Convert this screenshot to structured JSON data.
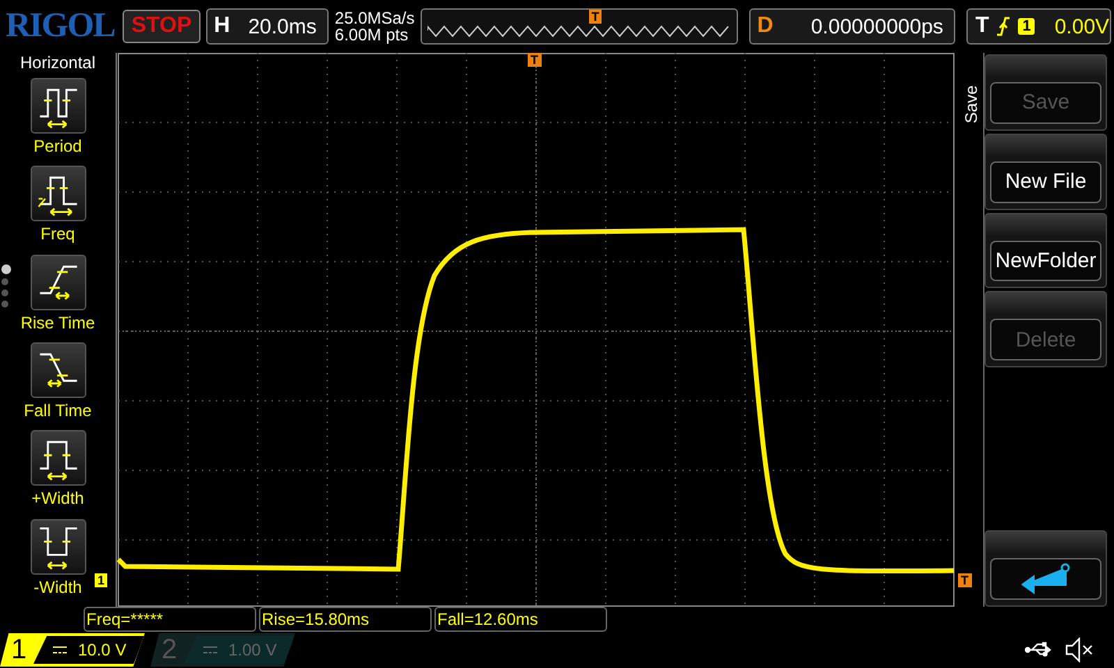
{
  "top_bar": {
    "logo": "RIGOL",
    "run_state": "STOP",
    "timebase": {
      "label": "H",
      "value": "20.0ms"
    },
    "sample_rate": "25.0MSa/s",
    "memory_depth": "6.00M pts",
    "trigger_position_marker": "T",
    "delay": {
      "label": "D",
      "value": "0.00000000ps"
    },
    "trigger": {
      "label": "T",
      "source": "1",
      "level": "0.00V"
    }
  },
  "measure_menu": {
    "title": "Horizontal",
    "pages": [
      {
        "selected": true
      },
      {
        "selected": false
      },
      {
        "selected": false
      },
      {
        "selected": false
      }
    ],
    "items": [
      {
        "kind": "period",
        "label": "Period"
      },
      {
        "kind": "freq",
        "label": "Freq"
      },
      {
        "kind": "rise",
        "label": "Rise Time"
      },
      {
        "kind": "fall",
        "label": "Fall Time"
      },
      {
        "kind": "pwidth",
        "label": "+Width"
      },
      {
        "kind": "nwidth",
        "label": "-Width"
      }
    ]
  },
  "screen": {
    "channel_marker": "1",
    "trigger_marker": "T",
    "trigger_level_marker": "T"
  },
  "soft_menu": {
    "title": "Save",
    "buttons": [
      {
        "kind": "text",
        "label": "Save",
        "disabled": true
      },
      {
        "kind": "text",
        "label": "New File",
        "disabled": false
      },
      {
        "kind": "text",
        "label": "NewFolder",
        "disabled": false
      },
      {
        "kind": "text",
        "label": "Delete",
        "disabled": true
      },
      {
        "kind": "spacer"
      },
      {
        "kind": "return",
        "disabled": false
      }
    ]
  },
  "measurements": [
    "Freq=*****",
    "Rise=15.80ms",
    "Fall=12.60ms"
  ],
  "channels": [
    {
      "number": "1",
      "scale": "10.0 V",
      "on": true
    },
    {
      "number": "2",
      "scale": "1.00 V",
      "on": false
    }
  ]
}
